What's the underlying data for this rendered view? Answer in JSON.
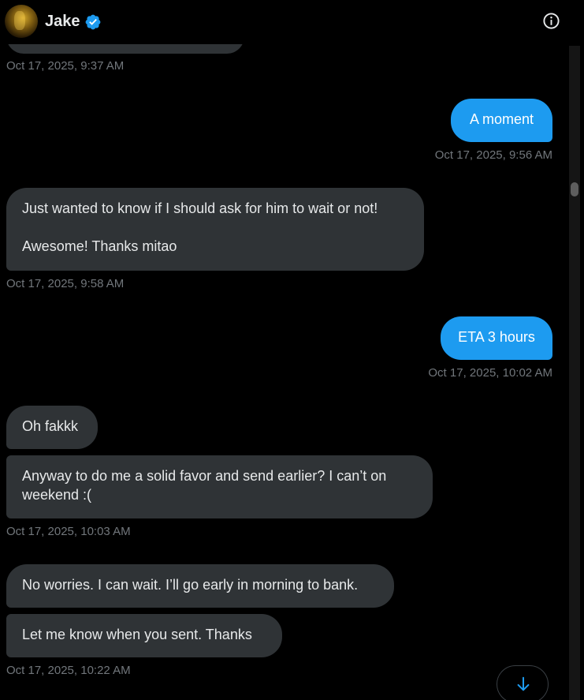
{
  "header": {
    "name": "Jake",
    "verified_icon": "verified-badge-icon",
    "info_icon": "info-icon"
  },
  "colors": {
    "background": "#000000",
    "received_bubble": "#2f3336",
    "sent_bubble": "#1d9bf0",
    "timestamp": "#71767b",
    "verified": "#1d9bf0"
  },
  "messages": [
    {
      "type": "timestamp",
      "side": "left",
      "text": "Oct 17, 2025, 9:37 AM"
    },
    {
      "type": "sent",
      "text": "A moment"
    },
    {
      "type": "timestamp",
      "side": "right",
      "text": "Oct 17, 2025, 9:56 AM"
    },
    {
      "type": "received",
      "text": "Just wanted to know if I should ask for him to wait or not!\n\nAwesome! Thanks mitao"
    },
    {
      "type": "timestamp",
      "side": "left",
      "text": "Oct 17, 2025, 9:58 AM"
    },
    {
      "type": "sent",
      "text": "ETA 3 hours"
    },
    {
      "type": "timestamp",
      "side": "right",
      "text": "Oct 17, 2025, 10:02 AM"
    },
    {
      "type": "received",
      "text": "Oh fakkk"
    },
    {
      "type": "received",
      "text": "Anyway to do me a solid favor and send earlier? I can’t on weekend :("
    },
    {
      "type": "timestamp",
      "side": "left",
      "text": "Oct 17, 2025, 10:03 AM"
    },
    {
      "type": "received",
      "text": "No worries. I can wait. I’ll go early in morning to bank."
    },
    {
      "type": "received",
      "text": "Let me know when you sent. Thanks"
    },
    {
      "type": "timestamp",
      "side": "left",
      "text": "Oct 17, 2025, 10:22 AM"
    }
  ],
  "scroll_down_icon": "arrow-down-icon"
}
